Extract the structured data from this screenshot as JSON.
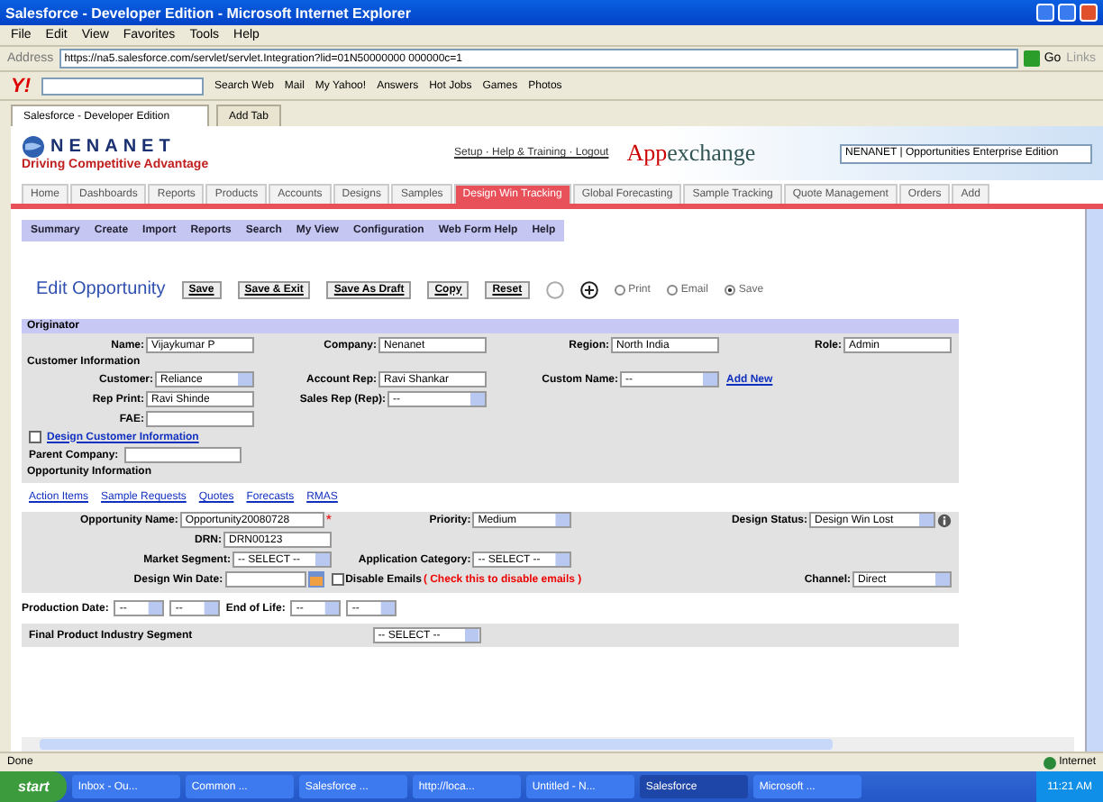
{
  "window": {
    "title": "Salesforce - Developer Edition - Microsoft Internet Explorer"
  },
  "menu": [
    "File",
    "Edit",
    "View",
    "Favorites",
    "Tools",
    "Help"
  ],
  "address": {
    "label": "Address",
    "url": "https://na5.salesforce.com/servlet/servlet.Integration?lid=01N50000000 000000c=1",
    "go": "Go",
    "links": "Links"
  },
  "toolbar_logo": "Y!",
  "toolbar": [
    "Search Web",
    "Mail",
    "My Yahoo!",
    "Answers",
    "Hot Jobs",
    "Games",
    "Photos"
  ],
  "browser_tabs": [
    {
      "label": "Salesforce - Developer Edition",
      "selected": true
    },
    {
      "label": "Add Tab",
      "selected": false
    }
  ],
  "header": {
    "brand": "NENANET",
    "tagline": "Driving Competitive Advantage",
    "top_links": "Setup · Help & Training · Logout",
    "exchange": "App",
    "exchange2": "exchange",
    "app_select": "NENANET | Opportunities Enterprise Edition"
  },
  "app_tabs": [
    {
      "label": "Home",
      "selected": false
    },
    {
      "label": "Dashboards",
      "selected": false
    },
    {
      "label": "Reports",
      "selected": false
    },
    {
      "label": "Products",
      "selected": false
    },
    {
      "label": "Accounts",
      "selected": false
    },
    {
      "label": "Designs",
      "selected": false
    },
    {
      "label": "Samples",
      "selected": false
    },
    {
      "label": "Design Win Tracking",
      "selected": true
    },
    {
      "label": "Global Forecasting",
      "selected": false
    },
    {
      "label": "Sample Tracking",
      "selected": false
    },
    {
      "label": "Quote Management",
      "selected": false
    },
    {
      "label": "Orders",
      "selected": false
    },
    {
      "label": "Add",
      "selected": false
    }
  ],
  "subnav": [
    "Summary",
    "Create",
    "Import",
    "Reports",
    "Search",
    "My View",
    "Configuration",
    "Web Form Help",
    "Help"
  ],
  "page": {
    "title": "Edit Opportunity",
    "buttons": [
      "Save",
      "Save & Exit",
      "Save As Draft",
      "Copy",
      "Reset"
    ],
    "radios": [
      {
        "label": "Print",
        "selected": false
      },
      {
        "label": "Email",
        "selected": false
      },
      {
        "label": "Save",
        "selected": true
      }
    ]
  },
  "originator": {
    "title": "Originator",
    "fields": [
      {
        "label": "Name:",
        "value": "Vijaykumar P",
        "kind": "text"
      },
      {
        "label": "Company:",
        "value": "Nenanet",
        "kind": "text"
      },
      {
        "label": "Region:",
        "value": "North India",
        "kind": "text"
      },
      {
        "label": "Role:",
        "value": "Admin",
        "kind": "text"
      }
    ]
  },
  "customer": {
    "title": "Customer Information",
    "rows": [
      [
        {
          "label": "Customer:",
          "value": "Reliance",
          "kind": "select"
        },
        {
          "label": "Account Rep:",
          "value": "Ravi Shankar",
          "kind": "text"
        },
        {
          "label": "Custom Name:",
          "value": "--",
          "kind": "select"
        },
        {
          "label": "Add New",
          "kind": "link"
        }
      ],
      [
        {
          "label": "Rep Print:",
          "value": "Ravi Shinde",
          "kind": "text"
        },
        {
          "label": "Sales Rep (Rep):",
          "value": "--",
          "kind": "select"
        }
      ],
      [
        {
          "label": "FAE:",
          "kind": "text"
        }
      ]
    ],
    "design_check": {
      "label": "Design Customer Information",
      "checked": false
    },
    "parent": {
      "label": "Parent Company:"
    },
    "opp_title": "Opportunity Information"
  },
  "links": [
    "Action Items",
    "Sample Requests",
    "Quotes",
    "Forecasts",
    "RMAS"
  ],
  "opportunity": {
    "rows": [
      [
        {
          "label": "Opportunity Name:",
          "value": "Opportunity20080728",
          "kind": "text",
          "required": "*"
        },
        {
          "label": "Priority:",
          "value": "Medium",
          "kind": "select"
        },
        {
          "label": "Design Status:",
          "value": "Design Win Lost",
          "kind": "select",
          "info": true
        }
      ],
      [
        {
          "label": "DRN:",
          "value": "DRN00123",
          "kind": "text"
        }
      ],
      [
        {
          "label": "Market Segment:",
          "value": "-- SELECT --",
          "kind": "select"
        },
        {
          "label": "Application Category:",
          "value": "-- SELECT --",
          "kind": "select"
        }
      ],
      [
        {
          "label": "Design Win Date:",
          "kind": "date"
        },
        {
          "label": "Disable Emails",
          "note": "( Check this to disable emails )",
          "kind": "checkbox",
          "checked": false
        },
        {
          "label": "Channel:",
          "value": "Direct",
          "kind": "select"
        }
      ]
    ]
  },
  "dates": [
    {
      "label": "Production Date:",
      "values": [
        "--",
        "--"
      ]
    },
    {
      "label": "End of Life:",
      "values": [
        "--",
        "--"
      ]
    }
  ],
  "final": {
    "label": "Final Product Industry Segment",
    "value": "-- SELECT --"
  },
  "status": {
    "text": "Done",
    "zone": "Internet"
  },
  "taskbar": {
    "start": "start",
    "items": [
      {
        "label": "Inbox - Ou...",
        "selected": false
      },
      {
        "label": "Common ...",
        "selected": false
      },
      {
        "label": "Salesforce ...",
        "selected": false
      },
      {
        "label": "http://loca...",
        "selected": false
      },
      {
        "label": "Untitled - N...",
        "selected": false
      },
      {
        "label": "Salesforce",
        "selected": true
      },
      {
        "label": "Microsoft ...",
        "selected": false
      }
    ],
    "clock": "11:21 AM"
  }
}
